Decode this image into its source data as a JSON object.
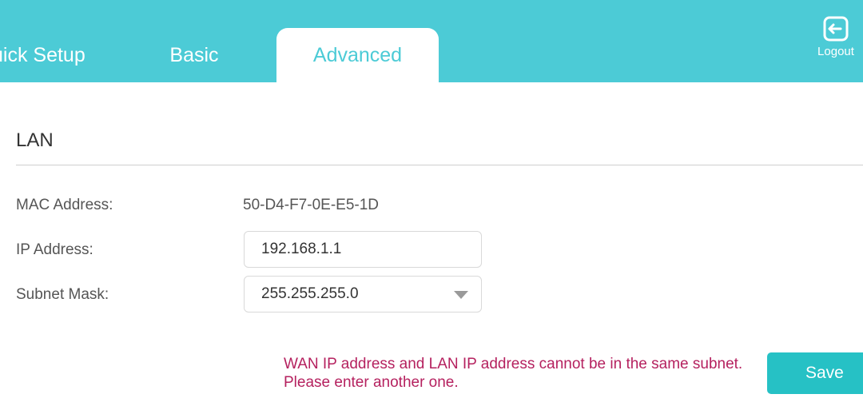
{
  "header": {
    "tabs": [
      {
        "label": "uick Setup"
      },
      {
        "label": "Basic"
      },
      {
        "label": "Advanced"
      }
    ],
    "logout_label": "Logout"
  },
  "lan": {
    "title": "LAN",
    "mac_label": "MAC Address:",
    "mac_value": "50-D4-F7-0E-E5-1D",
    "ip_label": "IP Address:",
    "ip_value": "192.168.1.1",
    "subnet_label": "Subnet Mask:",
    "subnet_value": "255.255.255.0"
  },
  "error": {
    "line1": "WAN IP address and LAN IP address cannot be in the same subnet.",
    "line2": "Please enter another one."
  },
  "actions": {
    "save_label": "Save"
  },
  "colors": {
    "header_bg": "#4ccbd6",
    "save_bg": "#26c1c5",
    "error_text": "#b5215f"
  }
}
